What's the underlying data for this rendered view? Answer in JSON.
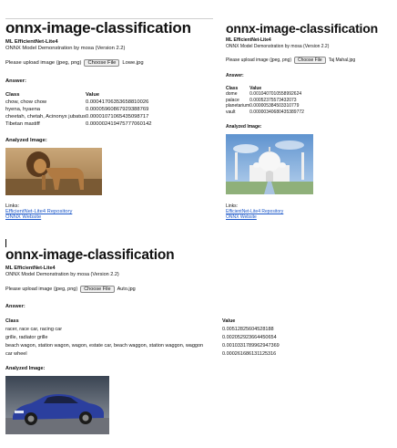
{
  "app_title": "onnx-image-classification",
  "model_name": "ML EfficientNet-Lite4",
  "description": "ONNX Model Demonstration by mosa (Version 2.2)",
  "upload_label": "Please upload image (jpeg, png)",
  "choose_file_label": "Choose File",
  "answer_heading": "Answer:",
  "analyzed_heading": "Analyzed Image:",
  "table_headers": {
    "class": "Class",
    "value": "Value"
  },
  "links": {
    "label": "Links:",
    "repo": "EfficientNet-Lite4 Repository",
    "website": "ONNX Website"
  },
  "panels": [
    {
      "filename": "Lowe.jpg",
      "results": [
        {
          "class": "chow, chow chow",
          "value": "0.00041706353658810026"
        },
        {
          "class": "hyena, hyaena",
          "value": "0.00005960867929388769"
        },
        {
          "class": "cheetah, chetah, Acinonyx jubatus",
          "value": "0.00001071065435098717"
        },
        {
          "class": "Tibetan mastiff",
          "value": "0.000002419475777060142"
        }
      ],
      "image_icon": "lion-photo"
    },
    {
      "filename": "Taj Mahal.jpg",
      "results": [
        {
          "class": "dome",
          "value": "0.0010407010558992624"
        },
        {
          "class": "palace",
          "value": "0.00052375573432073"
        },
        {
          "class": "planetarium",
          "value": "0.000005384503310779"
        },
        {
          "class": "vault",
          "value": "0.00000340680435389772"
        }
      ],
      "image_icon": "taj-mahal-photo"
    },
    {
      "filename": "Auto.jpg",
      "results": [
        {
          "class": "racer, race car, racing car",
          "value": "0.00512825604528188"
        },
        {
          "class": "grille, radiator grille",
          "value": "0.002052923664450654"
        },
        {
          "class": "beach wagon, station wagon, wagon, estate car, beach waggon, station waggon, waggon",
          "value": "0.0010331789962947369"
        },
        {
          "class": "car wheel",
          "value": "0.000261686131125316"
        }
      ],
      "image_icon": "car-photo"
    }
  ],
  "colors": {
    "link": "#1a56c8",
    "text": "#111111"
  }
}
